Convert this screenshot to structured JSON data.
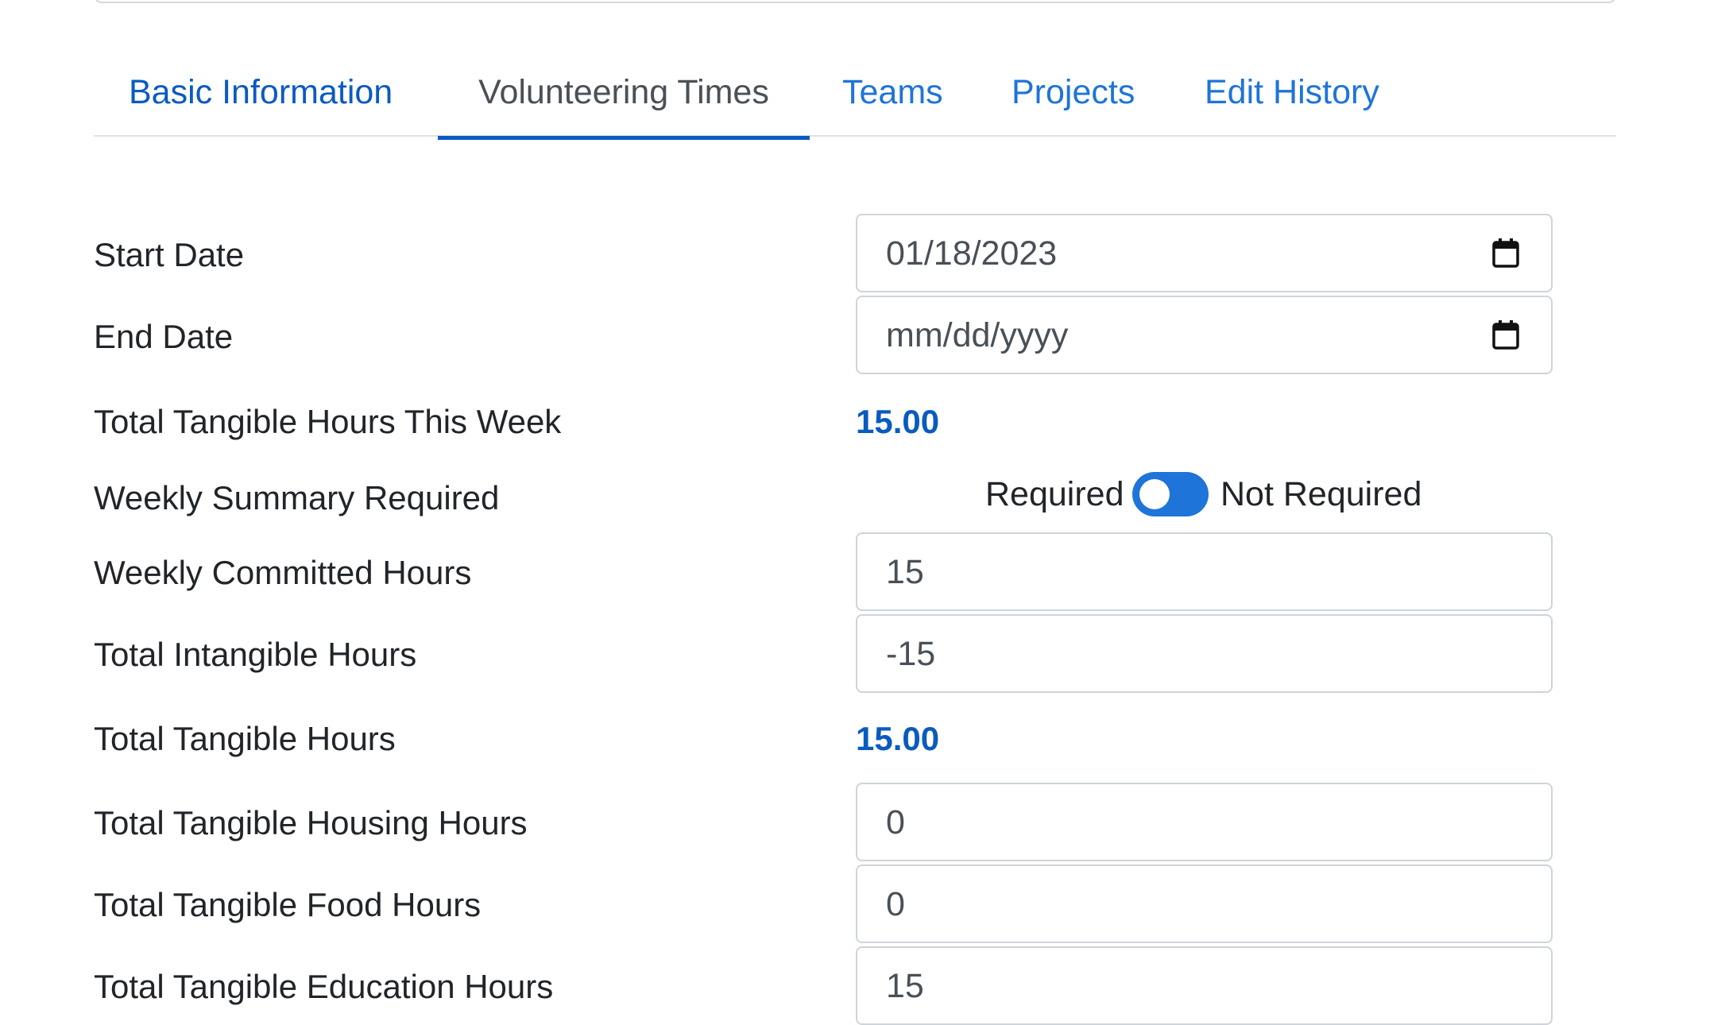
{
  "tabs": [
    {
      "label": "Basic Information"
    },
    {
      "label": "Volunteering Times"
    },
    {
      "label": "Teams"
    },
    {
      "label": "Projects"
    },
    {
      "label": "Edit History"
    }
  ],
  "active_tab": "Volunteering Times",
  "form": {
    "start_date": {
      "label": "Start Date",
      "value": "01/18/2023"
    },
    "end_date": {
      "label": "End Date",
      "placeholder": "mm/dd/yyyy"
    },
    "tangible_this_week": {
      "label": "Total Tangible Hours This Week",
      "value": "15.00"
    },
    "weekly_summary": {
      "label": "Weekly Summary Required",
      "left_label": "Required",
      "right_label": "Not Required",
      "state": "Not Required"
    },
    "weekly_committed": {
      "label": "Weekly Committed Hours",
      "value": "15"
    },
    "intangible": {
      "label": "Total Intangible Hours",
      "value": "-15"
    },
    "tangible_total": {
      "label": "Total Tangible Hours",
      "value": "15.00"
    },
    "housing": {
      "label": "Total Tangible Housing Hours",
      "value": "0"
    },
    "food": {
      "label": "Total Tangible Food Hours",
      "value": "0"
    },
    "education": {
      "label": "Total Tangible Education Hours",
      "value": "15"
    }
  },
  "colors": {
    "link": "#0a5bc0",
    "accent": "#1e74d9",
    "text": "#212529",
    "muted": "#495057",
    "border": "#ced4da"
  },
  "icons": {
    "calendar": "calendar-icon"
  }
}
